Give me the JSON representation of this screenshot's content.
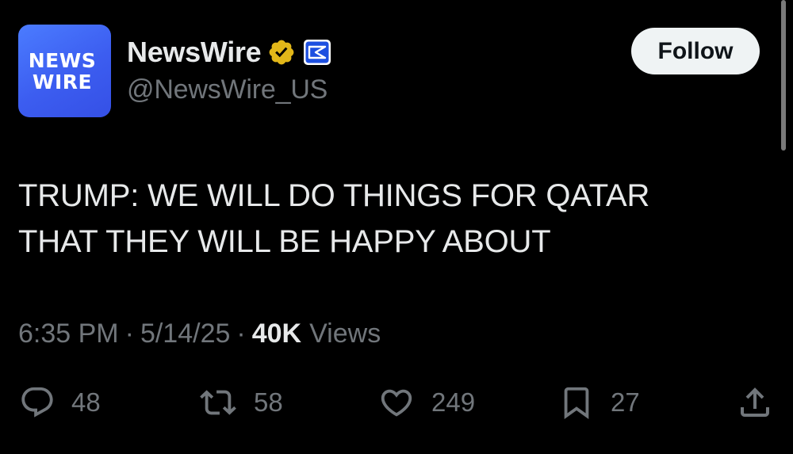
{
  "account": {
    "avatar_line1": "NEWS",
    "avatar_line2": "WIRE",
    "avatar_color": "#3d63f4",
    "display_name": "NewsWire",
    "handle": "@NewsWire_US",
    "verified_badge_color": "#e2b719",
    "affiliate_badge_color": "#1d4fe0"
  },
  "follow_button": {
    "label": "Follow"
  },
  "tweet": {
    "text_line1": "TRUMP: WE WILL DO THINGS FOR QATAR",
    "text_line2": "THAT THEY WILL BE HAPPY ABOUT"
  },
  "meta": {
    "time": "6:35 PM",
    "separator": "·",
    "date": "5/14/25",
    "views_count": "40K",
    "views_label": "Views"
  },
  "actions": {
    "replies": {
      "icon": "reply-icon",
      "count": "48"
    },
    "reposts": {
      "icon": "repost-icon",
      "count": "58"
    },
    "likes": {
      "icon": "like-icon",
      "count": "249"
    },
    "bookmarks": {
      "icon": "bookmark-icon",
      "count": "27"
    },
    "share": {
      "icon": "share-icon"
    }
  },
  "colors": {
    "background": "#000000",
    "primary_text": "#e7e9ea",
    "secondary_text": "#71767b",
    "follow_bg": "#eff3f4"
  }
}
